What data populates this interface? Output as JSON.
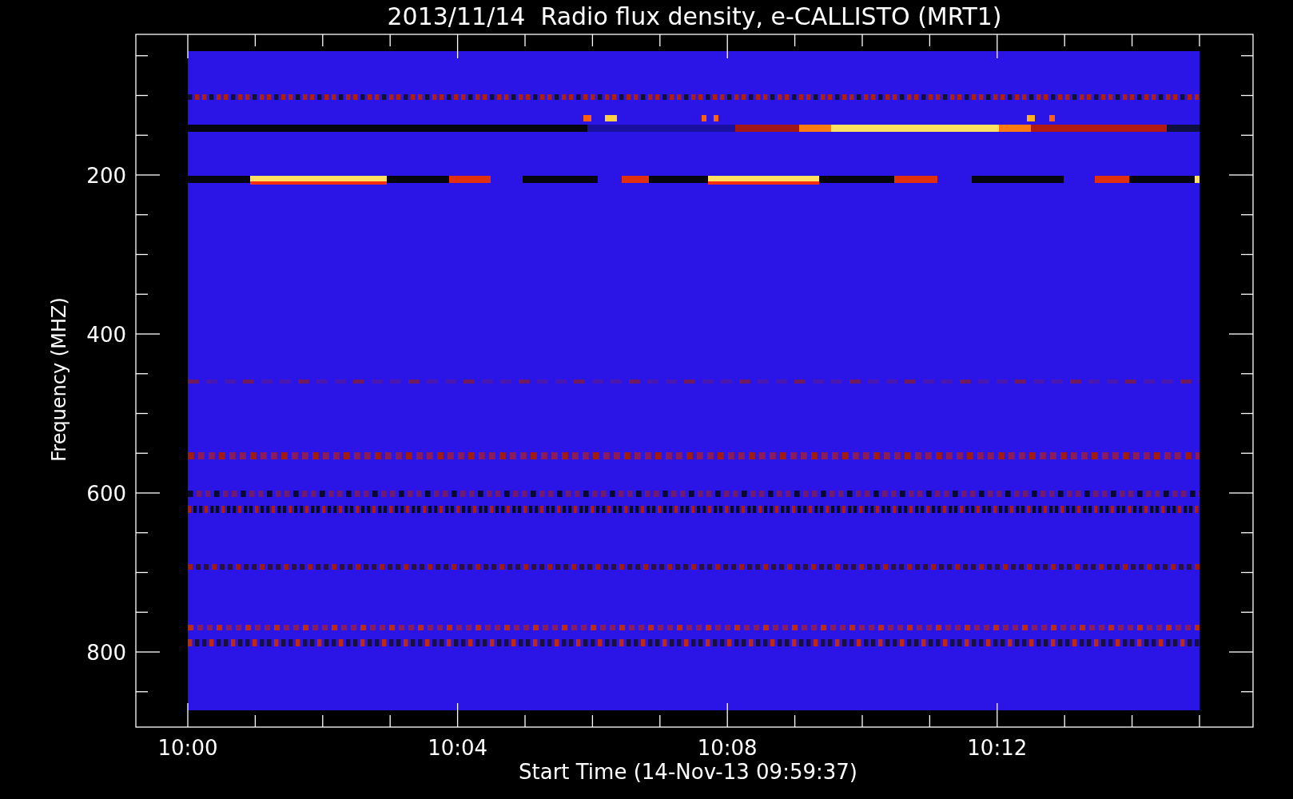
{
  "title": "2013/11/14  Radio flux density, e-CALLISTO (MRT1)",
  "ylabel": "Frequency (MHZ)",
  "xlabel": "Start Time (14-Nov-13 09:59:37)",
  "yticks": [
    "200",
    "400",
    "600",
    "800"
  ],
  "xticks": [
    "10:00",
    "10:04",
    "10:08",
    "10:12"
  ]
}
